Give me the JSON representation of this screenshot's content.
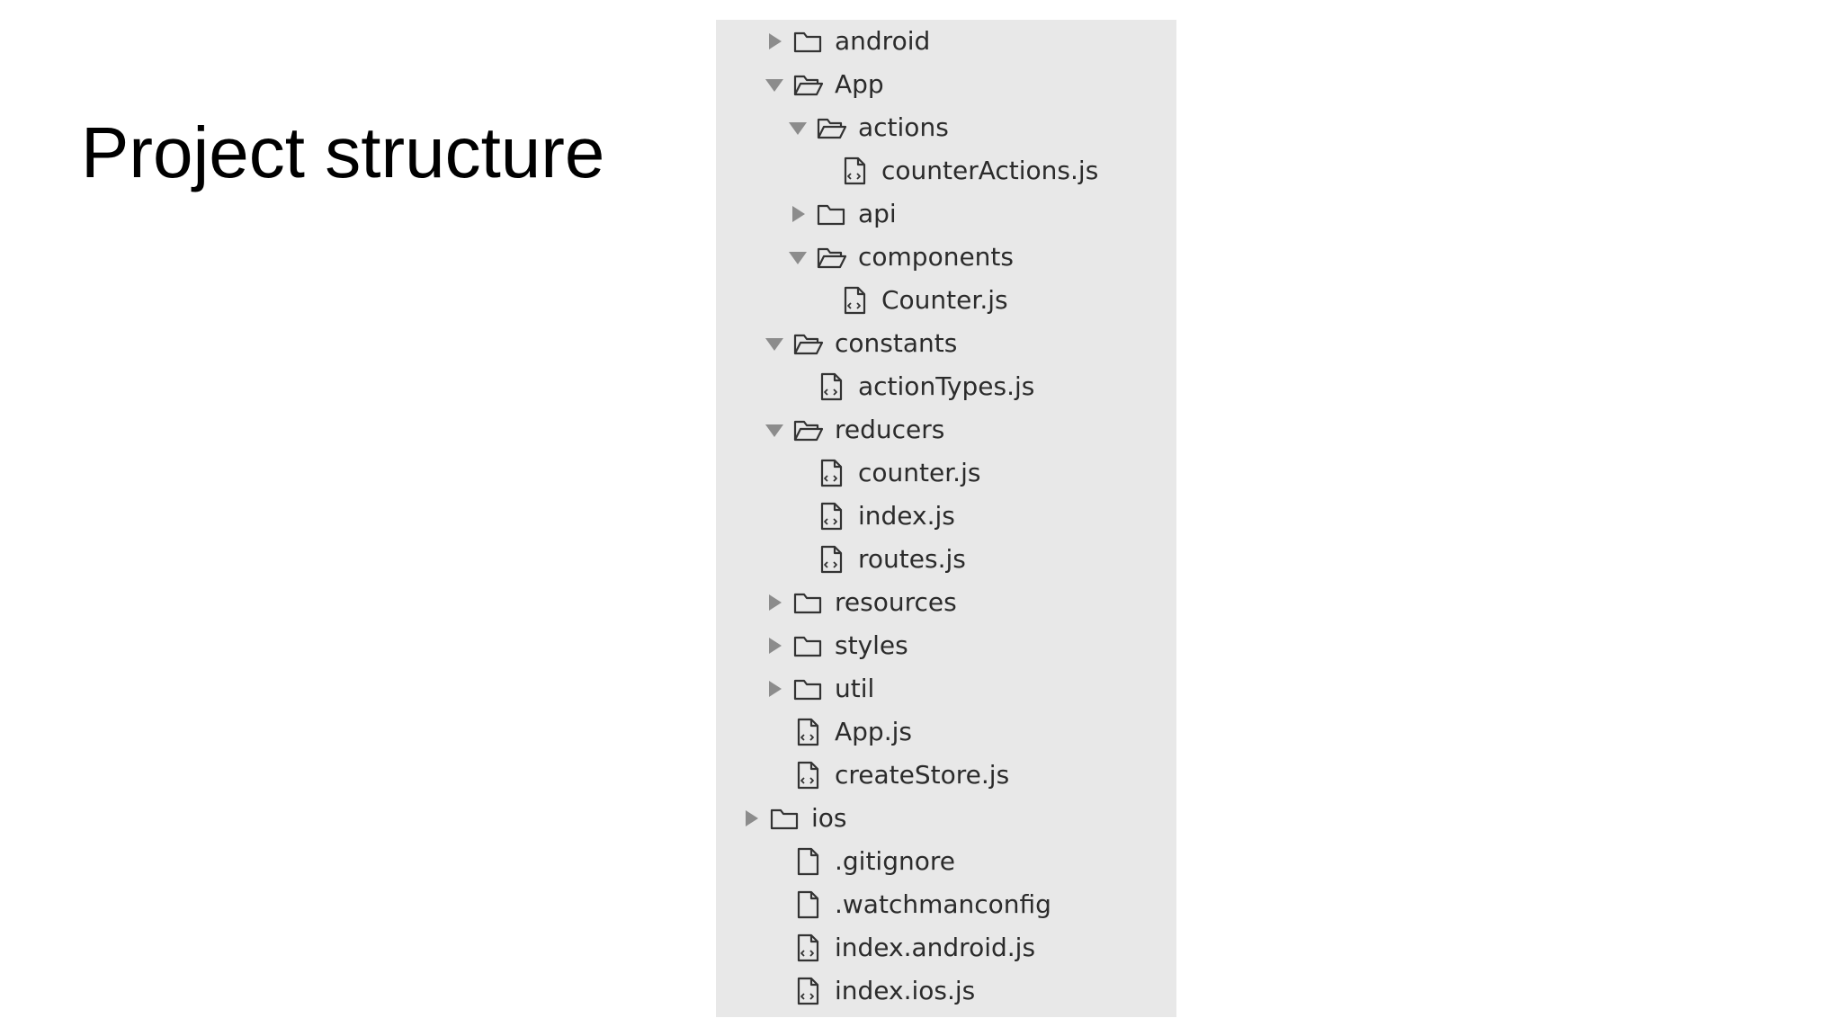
{
  "slide": {
    "title": "Project structure"
  },
  "tree": {
    "nodes": [
      {
        "label": "android",
        "type": "folder",
        "state": "collapsed",
        "depth": 0
      },
      {
        "label": "App",
        "type": "folder",
        "state": "expanded",
        "depth": 0
      },
      {
        "label": "actions",
        "type": "folder",
        "state": "expanded",
        "depth": 1
      },
      {
        "label": "counterActions.js",
        "type": "js-file",
        "depth": 2
      },
      {
        "label": "api",
        "type": "folder",
        "state": "collapsed",
        "depth": 1
      },
      {
        "label": "components",
        "type": "folder",
        "state": "expanded",
        "depth": 1
      },
      {
        "label": "Counter.js",
        "type": "js-file",
        "depth": 2
      },
      {
        "label": "constants",
        "type": "folder",
        "state": "expanded",
        "depth": 0
      },
      {
        "label": "actionTypes.js",
        "type": "js-file",
        "depth": 1
      },
      {
        "label": "reducers",
        "type": "folder",
        "state": "expanded",
        "depth": 0
      },
      {
        "label": "counter.js",
        "type": "js-file",
        "depth": 1
      },
      {
        "label": "index.js",
        "type": "js-file",
        "depth": 1
      },
      {
        "label": "routes.js",
        "type": "js-file",
        "depth": 1
      },
      {
        "label": "resources",
        "type": "folder",
        "state": "collapsed",
        "depth": 0
      },
      {
        "label": "styles",
        "type": "folder",
        "state": "collapsed",
        "depth": 0
      },
      {
        "label": "util",
        "type": "folder",
        "state": "collapsed",
        "depth": 0
      },
      {
        "label": "App.js",
        "type": "js-file",
        "depth": 0
      },
      {
        "label": "createStore.js",
        "type": "js-file",
        "depth": 0
      },
      {
        "label": "ios",
        "type": "folder",
        "state": "collapsed",
        "depth": -1
      },
      {
        "label": ".gitignore",
        "type": "file",
        "depth": 0
      },
      {
        "label": ".watchmanconfig",
        "type": "file",
        "depth": 0
      },
      {
        "label": "index.android.js",
        "type": "js-file",
        "depth": 0
      },
      {
        "label": "index.ios.js",
        "type": "js-file",
        "depth": 0
      }
    ]
  },
  "colors": {
    "panel_background": "#e8e8e8",
    "icon_stroke": "#333333",
    "arrow_fill": "#8c8c8c",
    "text": "#2b2b2b"
  }
}
